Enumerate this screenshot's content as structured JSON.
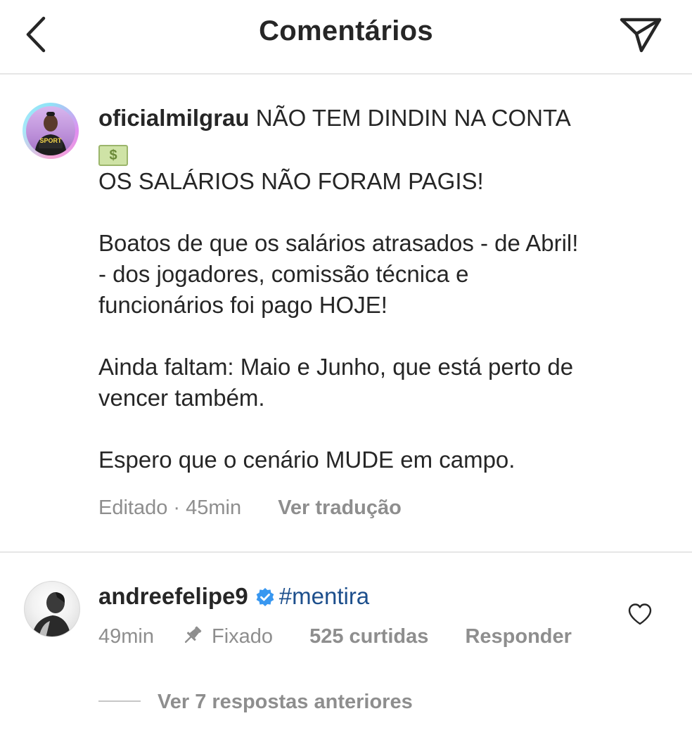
{
  "header": {
    "title": "Comentários",
    "back_icon": "chevron-left-icon",
    "send_icon": "paper-plane-icon"
  },
  "caption": {
    "username": "oficialmilgrau",
    "line1": "NÃO TEM DINDIN NA CONTA",
    "emoji": "money-bill-emoji",
    "line2": "OS SALÁRIOS NÃO FORAM PAGIS!",
    "paragraph1_line1": "Boatos de que os salários atrasados - de Abril!",
    "paragraph1_line2": "- dos jogadores, comissão técnica e",
    "paragraph1_line3": "funcionários foi pago HOJE!",
    "paragraph2_line1": "Ainda faltam: Maio e Junho, que está perto de",
    "paragraph2_line2": "vencer também.",
    "paragraph3_line1": "Espero que o cenário MUDE em campo.",
    "meta": "Editado · 45min",
    "translate_label": "Ver tradução",
    "avatar_badge": "SPORT"
  },
  "comment": {
    "username": "andreefelipe9",
    "verified": true,
    "text": "#mentira",
    "time": "49min",
    "pinned_label": "Fixado",
    "likes": "525 curtidas",
    "reply_label": "Responder",
    "view_replies": "Ver 7 respostas anteriores"
  },
  "colors": {
    "text": "#262626",
    "secondary": "#8e8e8e",
    "hashtag": "#1d4f8c",
    "verified": "#3897f0",
    "divider": "#e6e6e6"
  }
}
